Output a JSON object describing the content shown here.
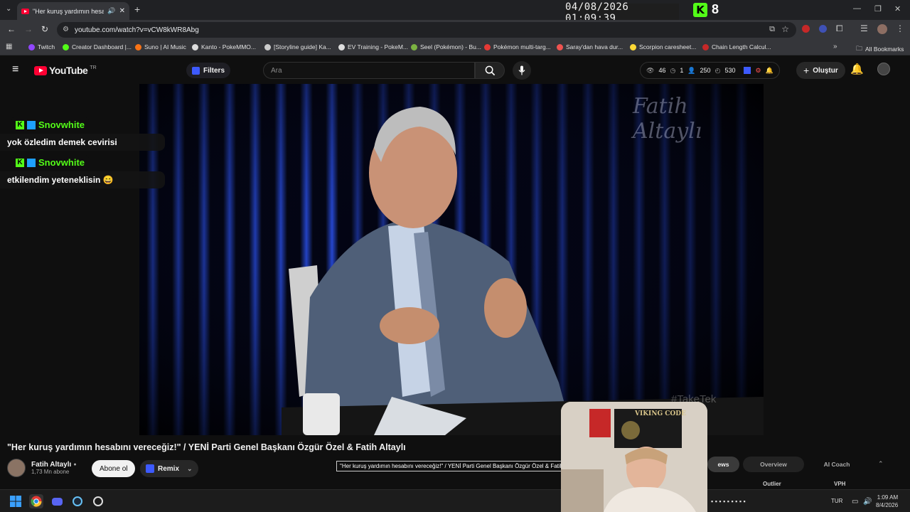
{
  "browser": {
    "tab_title": "\"Her kuruş yardımın hesab",
    "url": "youtube.com/watch?v=vCW8kWR8Abg"
  },
  "overlay": {
    "timestamp": "04/08/2026 01:09:39",
    "kick_count": "8"
  },
  "bookmarks": {
    "items": [
      {
        "label": "Twitch",
        "color": "#9146ff"
      },
      {
        "label": "Creator Dashboard |...",
        "color": "#53fc18"
      },
      {
        "label": "Suno | AI Music",
        "color": "#f97316"
      },
      {
        "label": "Kanto - PokeMMO...",
        "color": "#dddddd"
      },
      {
        "label": "[Storyline guide] Ka...",
        "color": "#cccccc"
      },
      {
        "label": "EV Training - PokeM...",
        "color": "#dddddd"
      },
      {
        "label": "Seel (Pokémon) - Bu...",
        "color": "#7cb342"
      },
      {
        "label": "Pokémon multi-targ...",
        "color": "#e53935"
      },
      {
        "label": "Saray'dan hava dur...",
        "color": "#ef5350"
      },
      {
        "label": "Scorpion caresheet...",
        "color": "#fdd835"
      },
      {
        "label": "Chain Length Calcul...",
        "color": "#c62828"
      }
    ],
    "all_label": "All Bookmarks"
  },
  "youtube": {
    "logo_text": "YouTube",
    "region": "TR",
    "filters_label": "Filters",
    "search_placeholder": "Ara",
    "stats": {
      "views": "46",
      "one": "1",
      "users": "250",
      "time": "530"
    },
    "create_label": "Oluştur"
  },
  "video": {
    "watermark": "Fatih Altaylı",
    "corner_tag": "#TakeTek",
    "title": "\"Her kuruş yardımın hesabını vereceğiz!\" / YENİ Parti Genel Başkanı Özgür Özel & Fatih Altaylı",
    "tooltip": "\"Her kuruş yardımın hesabını vereceğiz!\" / YENİ Parti Genel Başkanı Özgür Özel & Fatih A"
  },
  "channel": {
    "name": "Fatih Altaylı",
    "subs": "1,73 Mn abone",
    "subscribe_label": "Abone ol",
    "remix_label": "Remix"
  },
  "chat": [
    {
      "user": "Snovwhite",
      "text": "yok özledim demek cevirisi"
    },
    {
      "user": "Snovwhite",
      "text": "etkilendim yeteneklisin 😄"
    }
  ],
  "webcam": {
    "poster_text": "VIKING CODE"
  },
  "panel": {
    "tab_views": "ews",
    "tab_overview": "Overview",
    "tab_coach": "AI Coach",
    "outlier_label": "Outlier",
    "vph_label": "VPH"
  },
  "taskbar": {
    "lang": "TUR",
    "time": "1:09 AM",
    "date": "8/4/2026"
  },
  "colors": {
    "youtube_red": "#ff0033",
    "kick_green": "#53fc18"
  }
}
